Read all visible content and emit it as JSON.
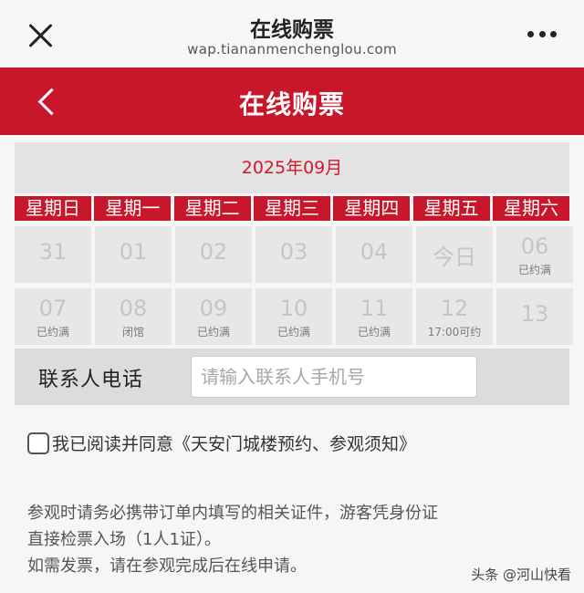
{
  "browser": {
    "title": "在线购票",
    "url": "wap.tiananmenchenglou.com"
  },
  "header": {
    "title": "在线购票"
  },
  "calendar": {
    "month": "2025年09月",
    "weekdays": [
      "星期日",
      "星期一",
      "星期二",
      "星期三",
      "星期四",
      "星期五",
      "星期六"
    ],
    "days": [
      {
        "num": "31",
        "status": ""
      },
      {
        "num": "01",
        "status": ""
      },
      {
        "num": "02",
        "status": ""
      },
      {
        "num": "03",
        "status": ""
      },
      {
        "num": "04",
        "status": ""
      },
      {
        "num": "今日",
        "status": ""
      },
      {
        "num": "06",
        "status": "已约满"
      },
      {
        "num": "07",
        "status": "已约满"
      },
      {
        "num": "08",
        "status": "闭馆"
      },
      {
        "num": "09",
        "status": "已约满"
      },
      {
        "num": "10",
        "status": "已约满"
      },
      {
        "num": "11",
        "status": "已约满"
      },
      {
        "num": "12",
        "status": "17:00可约"
      },
      {
        "num": "13",
        "status": ""
      }
    ]
  },
  "contact": {
    "label": "联系人电话",
    "placeholder": "请输入联系人手机号"
  },
  "agreement": {
    "text": "我已阅读并同意",
    "link": "《天安门城楼预约、参观须知》"
  },
  "notes": [
    "参观时请务必携带订单内填写的相关证件，游客凭身份证",
    "直接检票入场（1人1证）。",
    "如需发票，请在参观完成后在线申请。"
  ],
  "watermark": "头条 @河山快看",
  "colors": {
    "brand_red": "#c8172a",
    "month_text": "#d0192c"
  }
}
